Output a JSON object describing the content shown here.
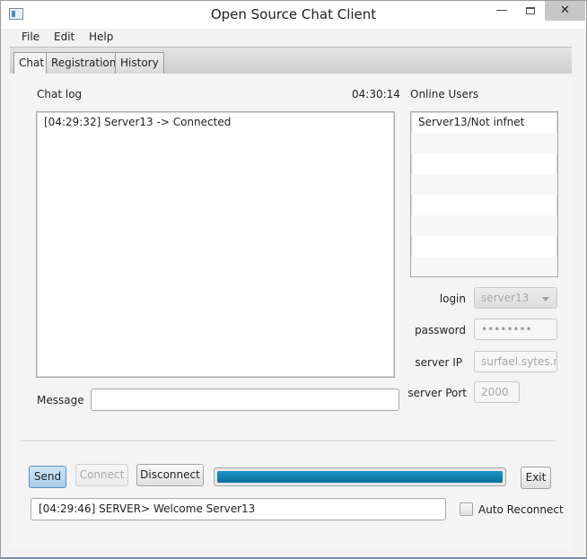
{
  "window": {
    "title": "Open Source Chat Client"
  },
  "titlebar": {
    "minimize": "—",
    "close": "✕"
  },
  "menu": {
    "items": [
      "File",
      "Edit",
      "Help"
    ]
  },
  "tabs": [
    {
      "label": "Chat",
      "active": true
    },
    {
      "label": "Registration",
      "active": false
    },
    {
      "label": "History",
      "active": false
    }
  ],
  "chat": {
    "log_label": "Chat log",
    "clock": "04:30:14",
    "log_lines": [
      "[04:29:32] Server13 -> Connected"
    ],
    "message_label": "Message",
    "message_value": ""
  },
  "users": {
    "label": "Online Users",
    "list": [
      "Server13/Not infnet",
      "",
      "",
      "",
      "",
      "",
      "",
      ""
    ]
  },
  "form": {
    "login_label": "login",
    "login_value": "server13",
    "password_label": "password",
    "password_value": "••••••••",
    "server_ip_label": "server IP",
    "server_ip_value": "surfael.sytes.ne",
    "server_port_label": "server Port",
    "server_port_value": "2000"
  },
  "buttons": {
    "send": "Send",
    "connect": "Connect",
    "disconnect": "Disconnect",
    "exit": "Exit"
  },
  "progress": {
    "value": 1.0
  },
  "status": {
    "text": "[04:29:46] SERVER> Welcome Server13",
    "auto_reconnect_label": "Auto Reconnect",
    "auto_reconnect_checked": false
  },
  "colors": {
    "accent": "#0a7fb0",
    "send_button": "#b7d7f0"
  }
}
